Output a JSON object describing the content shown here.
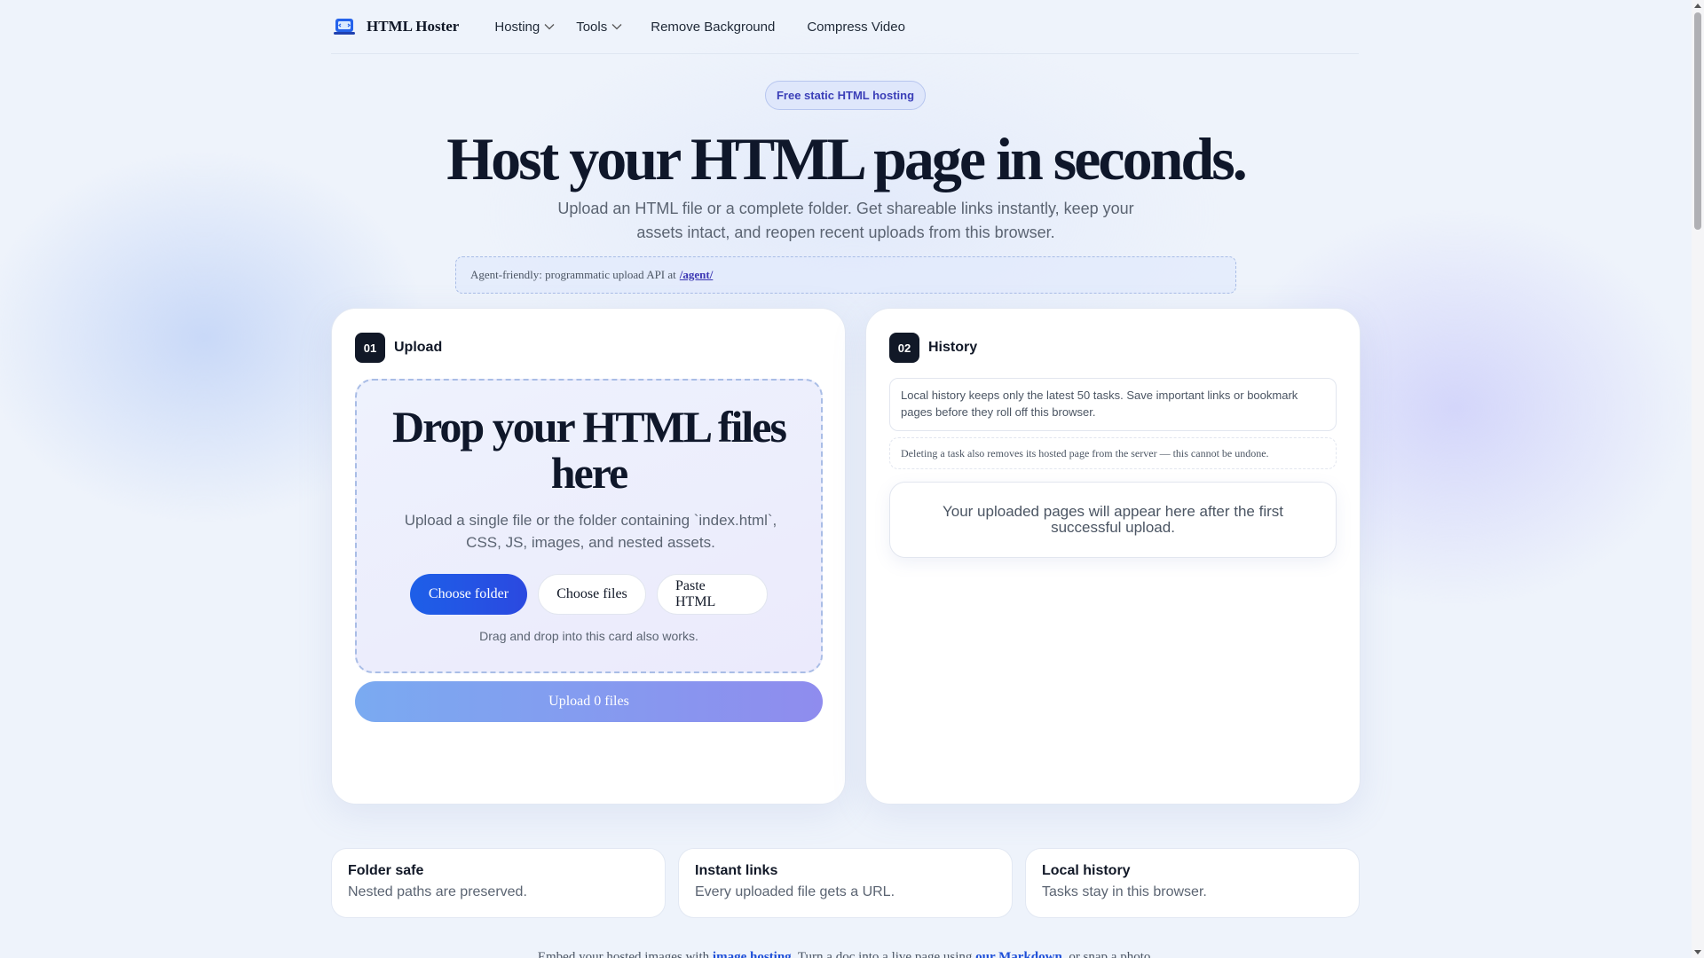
{
  "nav": {
    "brand": "HTML Hoster",
    "items": [
      {
        "label": "Hosting",
        "dropdown": true
      },
      {
        "label": "Tools",
        "dropdown": true
      },
      {
        "label": "Remove Background",
        "dropdown": false
      },
      {
        "label": "Compress Video",
        "dropdown": false
      }
    ]
  },
  "hero": {
    "badge": "Free static HTML hosting",
    "title": "Host your HTML page in seconds.",
    "subtitle": "Upload an HTML file or a complete folder. Get shareable links instantly, keep your assets intact, and reopen recent uploads from this browser.",
    "agent_text": "Agent-friendly: programmatic upload API at",
    "agent_link": "/agent/"
  },
  "upload": {
    "step": "01",
    "title": "Upload",
    "drop_title": "Drop your HTML files here",
    "drop_sub": "Upload a single file or the folder containing `index.html`, CSS, JS, images, and nested assets.",
    "buttons": {
      "choose_folder": "Choose folder",
      "choose_files": "Choose files",
      "paste_html": "Paste HTML"
    },
    "hint": "Drag and drop into this card also works.",
    "upload_button": "Upload 0 files"
  },
  "history": {
    "step": "02",
    "title": "History",
    "note1": "Local history keeps only the latest 50 tasks. Save important links or bookmark pages before they roll off this browser.",
    "note2": "Deleting a task also removes its hosted page from the server — this cannot be undone.",
    "empty": "Your uploaded pages will appear here after the first successful upload."
  },
  "features": [
    {
      "title": "Folder safe",
      "desc": "Nested paths are preserved."
    },
    {
      "title": "Instant links",
      "desc": "Every uploaded file gets a URL."
    },
    {
      "title": "Local history",
      "desc": "Tasks stay in this browser."
    }
  ],
  "footer": {
    "part1": "Embed your hosted images with ",
    "link1": "image hosting",
    "part2": ". Turn a doc into a live page using ",
    "link2": "our Markdown",
    "part3": ", or snap a photo."
  },
  "colors": {
    "accent": "#1d5fe8",
    "badge_text": "#3b3fb8",
    "dark": "#111827"
  }
}
